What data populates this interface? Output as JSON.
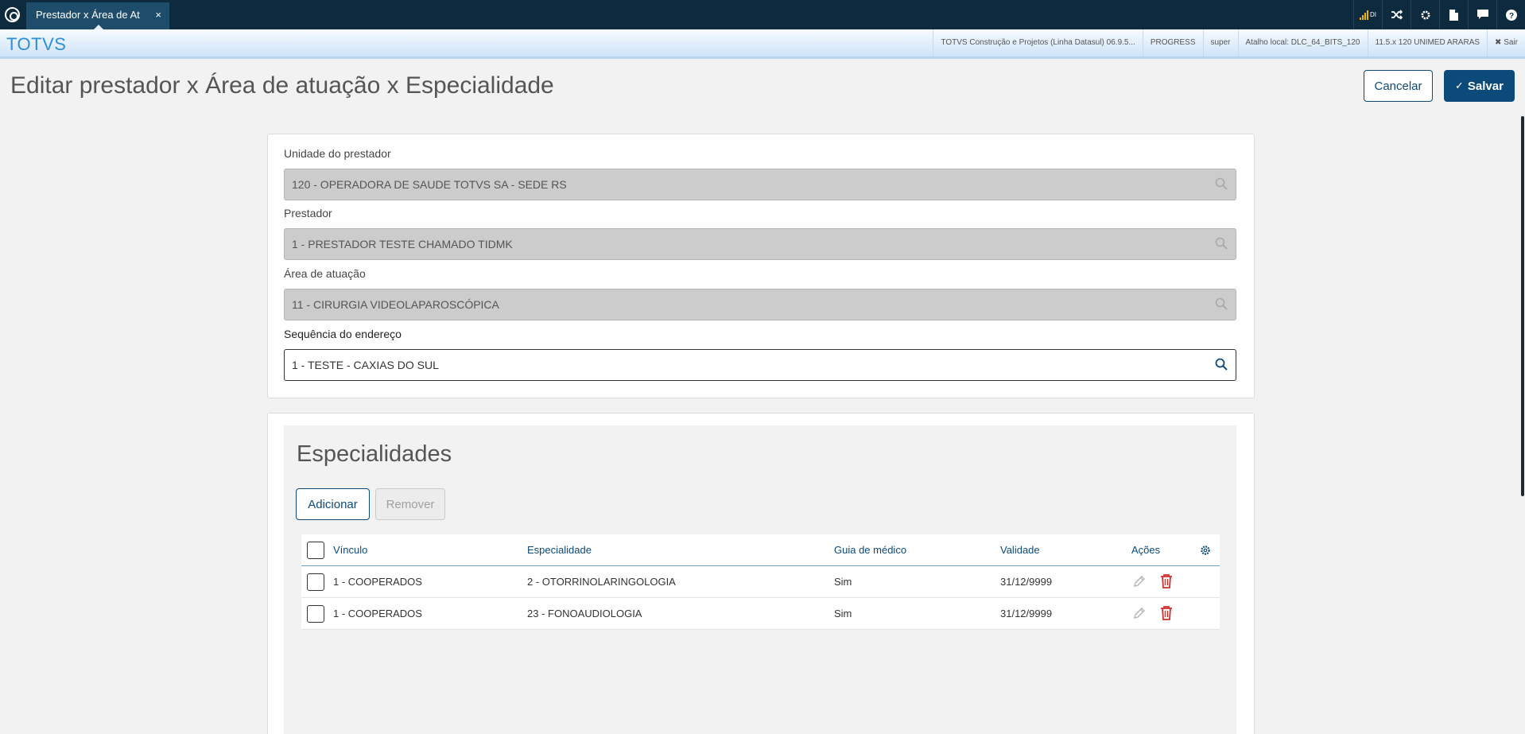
{
  "tab": {
    "title": "Prestador x Área de At",
    "close": "×"
  },
  "topbar": {
    "signal_label": "DI"
  },
  "header": {
    "brand": "TOTVS",
    "meta": [
      "TOTVS Construção e Projetos (Linha Datasul) 06.9.5...",
      "PROGRESS",
      "super",
      "Atalho local: DLC_64_BITS_120",
      "11.5.x 120 UNIMED ARARAS",
      "✖ Sair"
    ]
  },
  "page": {
    "title": "Editar prestador x Área de atuação x Especialidade",
    "cancel_label": "Cancelar",
    "save_label": "Salvar"
  },
  "form": {
    "unidade": {
      "label": "Unidade do prestador",
      "value": "120 - OPERADORA DE SAUDE TOTVS SA - SEDE RS"
    },
    "prestador": {
      "label": "Prestador",
      "value": "1 - PRESTADOR TESTE CHAMADO TIDMK"
    },
    "area": {
      "label": "Área de atuação",
      "value": "11 - CIRURGIA VIDEOLAPAROSCÓPICA"
    },
    "sequencia": {
      "label": "Sequência do endereço",
      "value": "1 - TESTE - CAXIAS DO SUL"
    }
  },
  "especialidades": {
    "title": "Especialidades",
    "add_label": "Adicionar",
    "remove_label": "Remover",
    "columns": {
      "vinculo": "Vínculo",
      "especialidade": "Especialidade",
      "guia": "Guia de médico",
      "validade": "Validade",
      "acoes": "Ações"
    },
    "rows": [
      {
        "vinculo": "1 - COOPERADOS",
        "especialidade": "2 - OTORRINOLARINGOLOGIA",
        "guia": "Sim",
        "validade": "31/12/9999"
      },
      {
        "vinculo": "1 - COOPERADOS",
        "especialidade": "23 - FONOAUDIOLOGIA",
        "guia": "Sim",
        "validade": "31/12/9999"
      }
    ]
  },
  "colors": {
    "primary": "#0c4a7a",
    "topbar": "#0d2a3f",
    "brand": "#2d8ed8",
    "delete": "#d0312d"
  }
}
